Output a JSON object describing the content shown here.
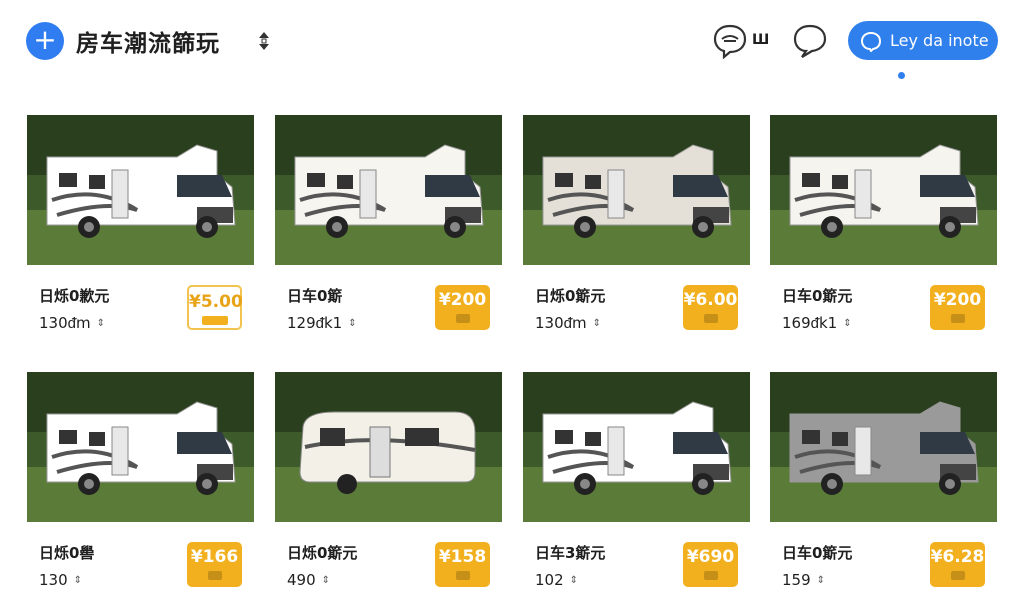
{
  "header": {
    "title": "房车潮流篩玩",
    "small_label": "Ш",
    "cta_label": "Ley da inote",
    "icons": {
      "add": "plus-icon",
      "sort": "sort-icon",
      "chat": "chat-icon",
      "bubble": "speech-bubble-icon"
    },
    "accent": "#2f80ec"
  },
  "cards": [
    {
      "name": "日烁0歉元",
      "sub": "130ᵭm",
      "price": "¥5.00",
      "outline": true,
      "color": "#ffffff"
    },
    {
      "name": "日车0簛",
      "sub": "129ᵭk1",
      "price": "¥200",
      "outline": false,
      "color": "#f7f5f0"
    },
    {
      "name": "日烁0簛元",
      "sub": "130ᵭm",
      "price": "¥6.00",
      "outline": false,
      "color": "#e4e0d8"
    },
    {
      "name": "日车0簛元",
      "sub": "169ᵭk1",
      "price": "¥200",
      "outline": false,
      "color": "#f6f4ef"
    },
    {
      "name": "日烁0嚳",
      "sub": "130",
      "price": "¥166",
      "outline": false,
      "color": "#ffffff"
    },
    {
      "name": "日烁0簛元",
      "sub": "490",
      "price": "¥158",
      "outline": false,
      "color": "#f3f0e8"
    },
    {
      "name": "日车3簛元",
      "sub": "102",
      "price": "¥690",
      "outline": false,
      "color": "#ffffff"
    },
    {
      "name": "日车0簛元",
      "sub": "159",
      "price": "¥6.28",
      "outline": false,
      "color": "#9a9a9a"
    }
  ]
}
